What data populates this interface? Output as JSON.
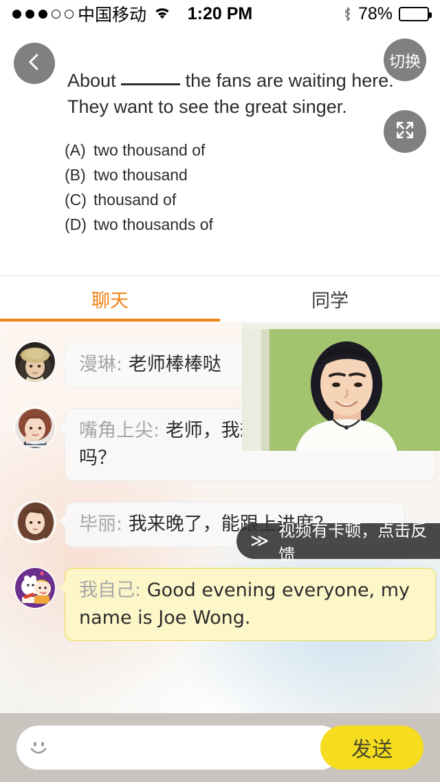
{
  "status_bar": {
    "signal_dots": [
      "full",
      "full",
      "full",
      "empty",
      "empty"
    ],
    "carrier": "中国移动",
    "wifi_icon": "wifi-icon",
    "time": "1:20 PM",
    "bluetooth_icon": "bluetooth-icon",
    "battery_percent": "78%",
    "battery_level": 78
  },
  "question": {
    "back_icon": "chevron-left-icon",
    "switch_label": "切换",
    "fullscreen_icon": "expand-arrows-icon",
    "line1_before": "About",
    "line1_after": "the fans are waiting here.",
    "line2": "They want to see the great singer.",
    "options": [
      {
        "key": "(A)",
        "text": "two thousand of"
      },
      {
        "key": "(B)",
        "text": "two thousand"
      },
      {
        "key": "(C)",
        "text": "thousand of"
      },
      {
        "key": "(D)",
        "text": "two thousands of"
      }
    ]
  },
  "tabs": [
    {
      "label": "聊天",
      "active": true
    },
    {
      "label": "同学",
      "active": false
    }
  ],
  "chat": {
    "messages": [
      {
        "avatar": "avatar-manlin",
        "sender": "漫琳:",
        "text": "老师棒棒哒",
        "mine": false
      },
      {
        "avatar": "avatar-zuijiaoshangjian",
        "sender": "嘴角上尖:",
        "text": "老师，我想和您聊聊你，可以吗？",
        "mine": false
      },
      {
        "avatar": "avatar-bili",
        "sender": "毕丽:",
        "text": "我来晚了，能跟上进度？",
        "mine": false
      },
      {
        "avatar": "avatar-self",
        "sender": "我自己:",
        "text": "Good evening everyone, my name is Joe Wong.",
        "mine": true
      }
    ]
  },
  "video": {
    "label": "teacher-video-feed"
  },
  "toast": {
    "chevron": "≫",
    "text": "视频有卡顿，点击反馈"
  },
  "input_bar": {
    "smiley_icon": "smiley-icon",
    "value": "",
    "placeholder": "",
    "send_label": "发送"
  },
  "colors": {
    "accent_orange": "#ee8013",
    "send_yellow": "#f5dc1e",
    "own_bubble": "#fdf6c8",
    "button_gray": "#808080"
  }
}
